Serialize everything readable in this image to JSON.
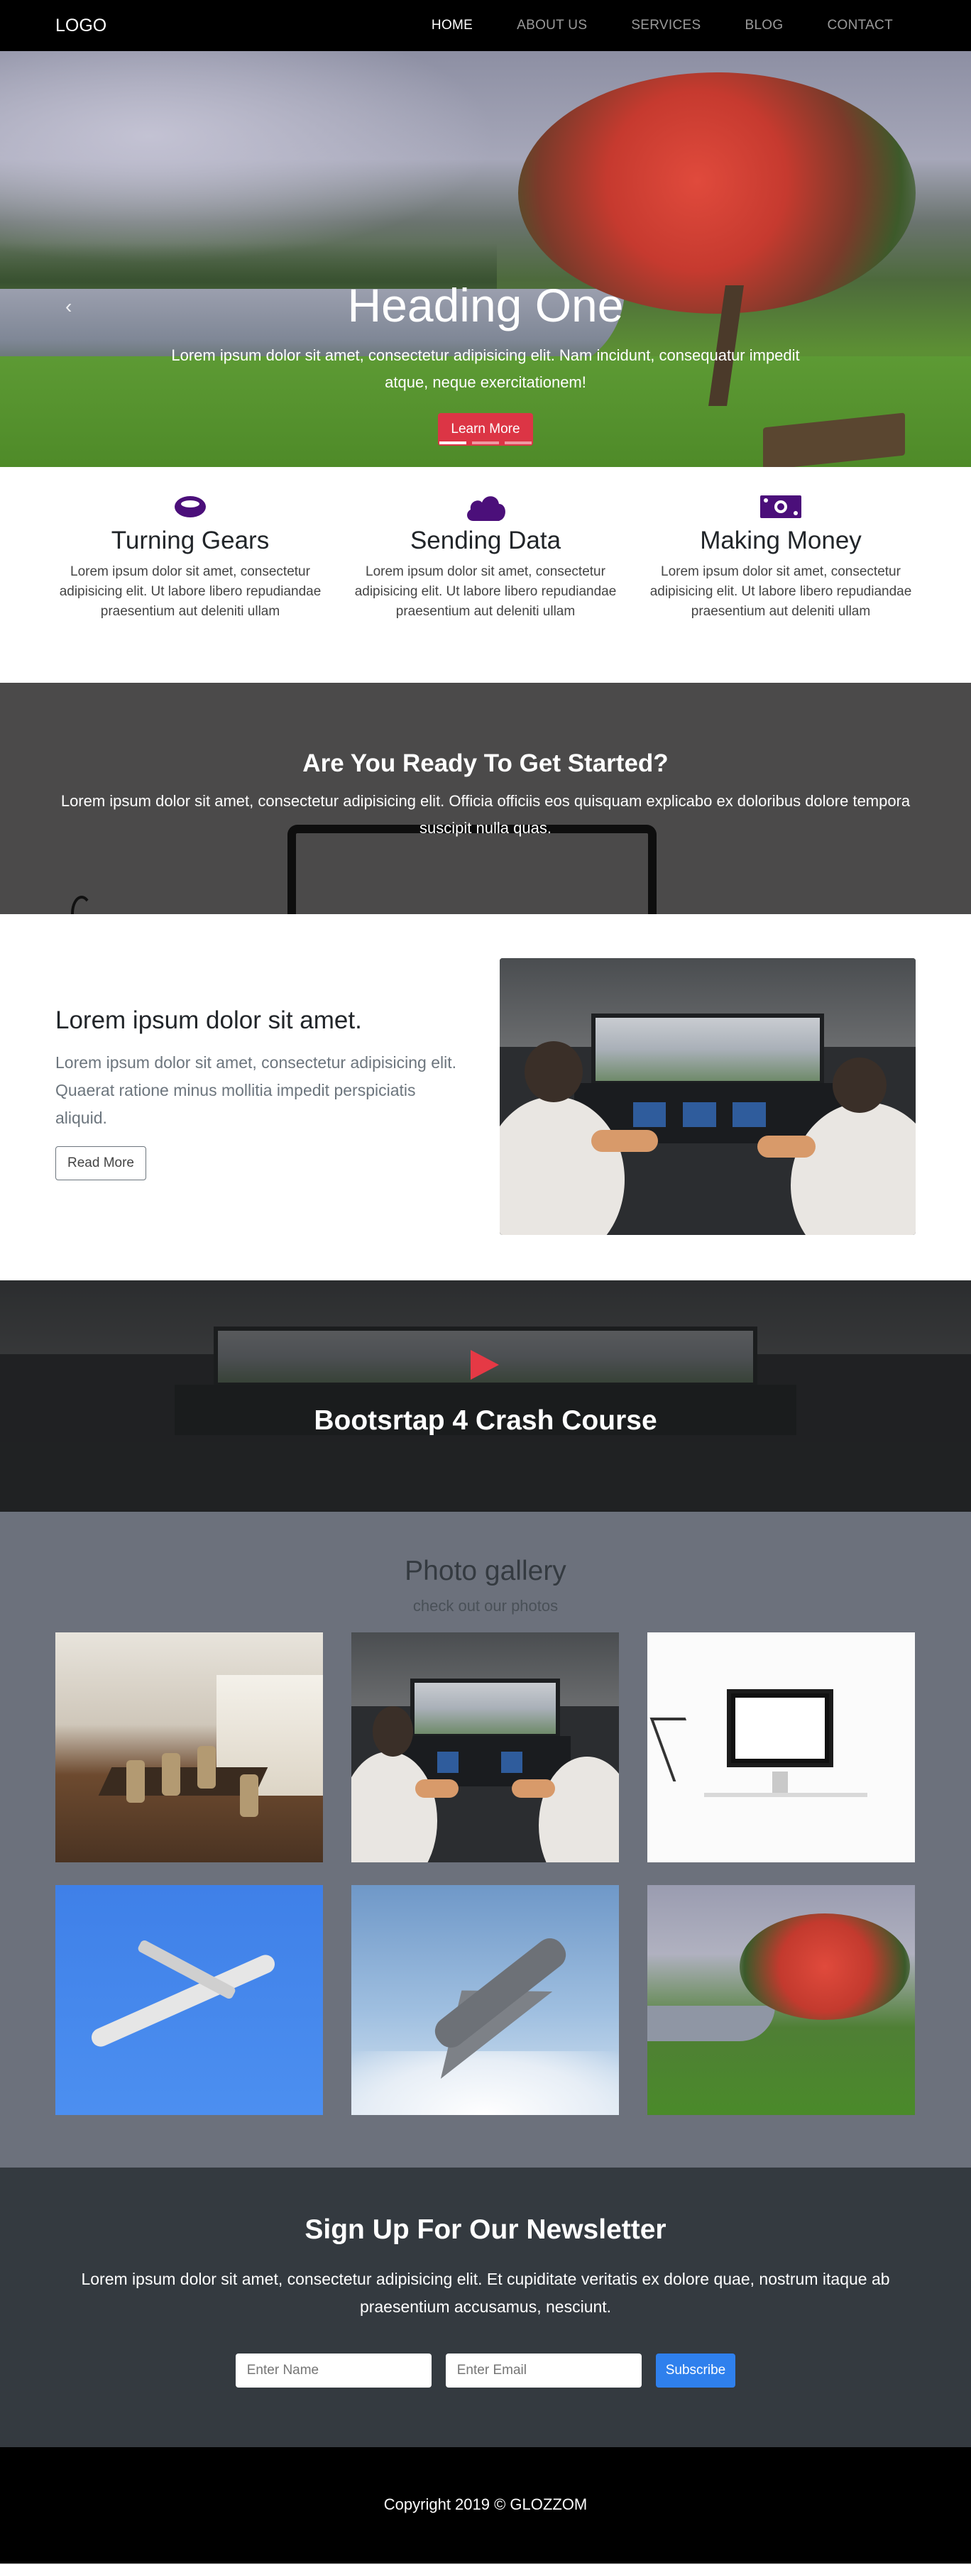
{
  "nav": {
    "logo": "LOGO",
    "items": [
      {
        "label": "HOME",
        "active": true
      },
      {
        "label": "ABOUT US"
      },
      {
        "label": "SERVICES"
      },
      {
        "label": "BLOG"
      },
      {
        "label": "CONTACT"
      }
    ]
  },
  "hero": {
    "title": "Heading One",
    "text": "Lorem ipsum dolor sit amet, consectetur adipisicing elit. Nam incidunt, consequatur impedit atque, neque exercitationem!",
    "button": "Learn More",
    "slides": 3,
    "active_slide": 1
  },
  "features": [
    {
      "icon": "ring-icon",
      "title": "Turning Gears",
      "text": "Lorem ipsum dolor sit amet, consectetur adipisicing elit. Ut labore libero repudiandae praesentium aut deleniti ullam"
    },
    {
      "icon": "cloud-icon",
      "title": "Sending Data",
      "text": "Lorem ipsum dolor sit amet, consectetur adipisicing elit. Ut labore libero repudiandae praesentium aut deleniti ullam"
    },
    {
      "icon": "money-icon",
      "title": "Making Money",
      "text": "Lorem ipsum dolor sit amet, consectetur adipisicing elit. Ut labore libero repudiandae praesentium aut deleniti ullam"
    }
  ],
  "cta": {
    "title": "Are You Ready To Get Started?",
    "text": "Lorem ipsum dolor sit amet, consectetur adipisicing elit. Officia officiis eos quisquam explicabo ex doloribus dolore tempora suscipit nulla quas."
  },
  "info": {
    "title": "Lorem ipsum dolor sit amet.",
    "text": "Lorem ipsum dolor sit amet, consectetur adipisicing elit. Quaerat ratione minus mollitia impedit perspiciatis aliquid.",
    "button": "Read More"
  },
  "video": {
    "title": "Bootsrtap 4 Crash Course"
  },
  "gallery": {
    "title": "Photo gallery",
    "subtitle": "check out our photos"
  },
  "newsletter": {
    "title": "Sign Up For Our Newsletter",
    "text": "Lorem ipsum dolor sit amet, consectetur adipisicing elit. Et cupiditate veritatis ex dolore quae, nostrum itaque ab praesentium accusamus, nesciunt.",
    "name_placeholder": "Enter Name",
    "email_placeholder": "Enter Email",
    "button": "Subscribe"
  },
  "footer": {
    "text": "Copyright 2019 © GLOZZOM"
  },
  "colors": {
    "accent_red": "#dc3545",
    "icon_purple": "#4b0f7a",
    "subscribe_blue": "#2f80ed",
    "gallery_bg": "#6c717c",
    "newsletter_bg": "#343a40"
  }
}
